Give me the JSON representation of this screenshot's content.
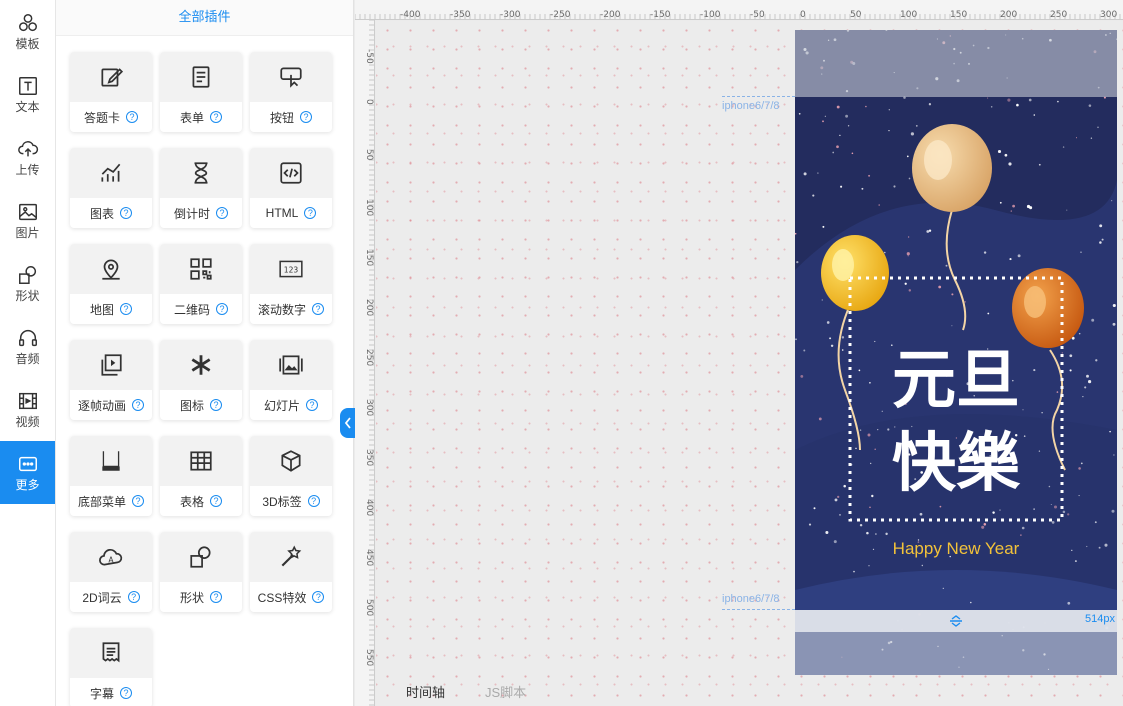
{
  "rail": [
    {
      "label": "模板",
      "icon": "template-icon"
    },
    {
      "label": "文本",
      "icon": "text-icon"
    },
    {
      "label": "上传",
      "icon": "upload-cloud-icon"
    },
    {
      "label": "图片",
      "icon": "image-icon"
    },
    {
      "label": "形状",
      "icon": "shape-icon"
    },
    {
      "label": "音频",
      "icon": "headphones-icon"
    },
    {
      "label": "视频",
      "icon": "film-icon"
    },
    {
      "label": "更多",
      "icon": "more-icon",
      "active": true
    }
  ],
  "panel": {
    "title": "全部插件",
    "plugins": [
      {
        "label": "答题卡",
        "icon": "edit-icon"
      },
      {
        "label": "表单",
        "icon": "form-icon"
      },
      {
        "label": "按钮",
        "icon": "button-icon"
      },
      {
        "label": "图表",
        "icon": "chart-icon"
      },
      {
        "label": "倒计时",
        "icon": "hourglass-icon"
      },
      {
        "label": "HTML",
        "icon": "code-icon"
      },
      {
        "label": "地图",
        "icon": "map-pin-icon"
      },
      {
        "label": "二维码",
        "icon": "qrcode-icon"
      },
      {
        "label": "滚动数字",
        "icon": "number-icon"
      },
      {
        "label": "逐帧动画",
        "icon": "frames-icon"
      },
      {
        "label": "图标",
        "icon": "asterisk-icon"
      },
      {
        "label": "幻灯片",
        "icon": "slides-icon"
      },
      {
        "label": "底部菜单",
        "icon": "bottom-menu-icon"
      },
      {
        "label": "表格",
        "icon": "table-icon"
      },
      {
        "label": "3D标签",
        "icon": "cube-icon"
      },
      {
        "label": "2D词云",
        "icon": "word-cloud-icon"
      },
      {
        "label": "形状",
        "icon": "shape-icon"
      },
      {
        "label": "CSS特效",
        "icon": "magic-wand-icon"
      },
      {
        "label": "字幕",
        "icon": "subtitle-icon"
      }
    ],
    "help_glyph": "?"
  },
  "ruler": {
    "top_labels": [
      "-400",
      "-350",
      "-300",
      "-250",
      "-200",
      "-150",
      "-100",
      "-50",
      "0",
      "50",
      "100",
      "150",
      "200",
      "250",
      "300"
    ],
    "left_labels": [
      "-50",
      "0",
      "50",
      "100",
      "150",
      "200",
      "250",
      "300",
      "350",
      "400",
      "450",
      "500",
      "550"
    ]
  },
  "canvas": {
    "device_label_top": "iphone6/7/8",
    "device_label_bottom": "iphone6/7/8",
    "height_readout": "514px",
    "poster": {
      "title_line1": "元旦",
      "title_line2": "快樂",
      "greeting": "Happy New Year"
    }
  },
  "bottom_tabs": {
    "timeline": "时间轴",
    "js_script": "JS脚本"
  },
  "colors": {
    "accent": "#1a8cf0",
    "poster_bg": "#232c5e",
    "gold": "#f2c23a"
  }
}
